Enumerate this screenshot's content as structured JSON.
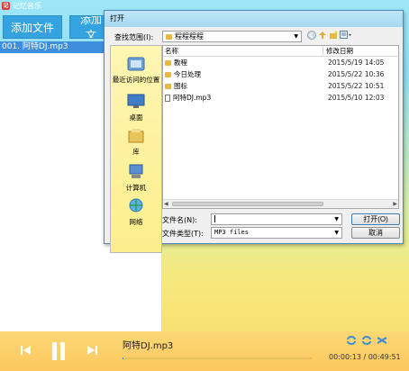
{
  "app": {
    "title": "记忆音乐",
    "icon_letter": "记"
  },
  "player": {
    "add_file_label": "添加文件",
    "add_folder_label": "添加文",
    "playlist": [
      {
        "label": "001. 阿特DJ.mp3"
      }
    ],
    "now_playing": "阿特DJ.mp3",
    "time": "00:00:13 / 00:49:51",
    "progress": 0.004
  },
  "dialog": {
    "title": "打开",
    "look_in_label": "查找范围(I):",
    "look_in_value": "程程程程",
    "places": [
      {
        "label": "最近访问的位置",
        "icon": "recent-places-icon"
      },
      {
        "label": "桌面",
        "icon": "desktop-icon"
      },
      {
        "label": "库",
        "icon": "library-icon"
      },
      {
        "label": "计算机",
        "icon": "computer-icon"
      },
      {
        "label": "网络",
        "icon": "network-icon"
      }
    ],
    "columns": {
      "name": "名称",
      "date": "修改日期"
    },
    "files": [
      {
        "name": "教程",
        "date": "2015/5/19 14:05",
        "type": "folder"
      },
      {
        "name": "今日处理",
        "date": "2015/5/22 10:36",
        "type": "folder"
      },
      {
        "name": "图标",
        "date": "2015/5/22 10:51",
        "type": "folder"
      },
      {
        "name": "阿特DJ.mp3",
        "date": "2015/5/10 12:03",
        "type": "mp3"
      }
    ],
    "file_name_label": "文件名(N):",
    "file_name_value": "",
    "file_type_label": "文件类型(T):",
    "file_type_value": "MP3 files",
    "open_label": "打开(O)",
    "cancel_label": "取消"
  },
  "colors": {
    "accent": "#34a3e0",
    "playlist_selected": "#3d8fde",
    "bottom_bar": "#fbc85f"
  }
}
